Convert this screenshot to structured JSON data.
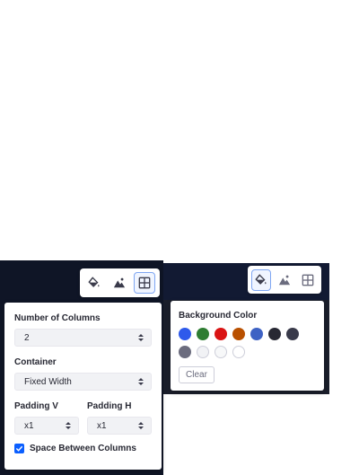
{
  "layout_popover": {
    "columns_label": "Number of Columns",
    "columns_value": "2",
    "container_label": "Container",
    "container_value": "Fixed Width",
    "padding_v_label": "Padding V",
    "padding_v_value": "x1",
    "padding_h_label": "Padding H",
    "padding_h_value": "x1",
    "space_between_label": "Space Between Columns",
    "space_between_checked": true
  },
  "background_popover": {
    "title": "Background Color",
    "clear_label": "Clear",
    "swatches": [
      "#2e5aeb",
      "#2e7d32",
      "#da1414",
      "#b95000",
      "#3e62c4",
      "#272833",
      "#393a4a",
      "#6b6c7e",
      "#f1f2f5",
      "#f7f8f9",
      "#ffffff"
    ]
  },
  "toolbar_left": {
    "icons": [
      "paint-bucket-icon",
      "image-icon",
      "grid-icon"
    ],
    "active": "grid-icon"
  },
  "toolbar_right": {
    "icons": [
      "paint-bucket-icon",
      "image-icon",
      "grid-icon"
    ],
    "active": "paint-bucket-icon"
  },
  "colors": {
    "accent": "#0b5fff",
    "active_border": "#7fa6f2"
  }
}
